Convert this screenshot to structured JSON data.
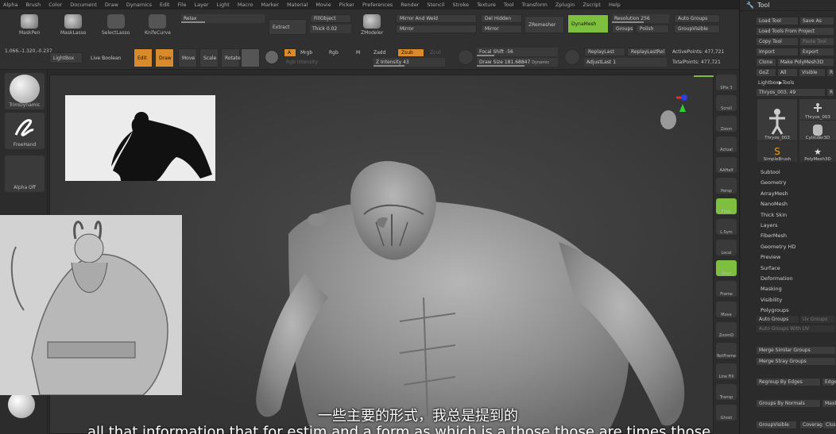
{
  "menu": [
    "Alpha",
    "Brush",
    "Color",
    "Document",
    "Draw",
    "Dynamics",
    "Edit",
    "File",
    "Layer",
    "Light",
    "Macro",
    "Marker",
    "Material",
    "Movie",
    "Picker",
    "Preferences",
    "Render",
    "Stencil",
    "Stroke",
    "Texture",
    "Tool",
    "Transform",
    "Zplugin",
    "Zscript",
    "Help"
  ],
  "coords": "1.066,-1.320,-0.237",
  "top_tools": {
    "masked": "MaskPen",
    "masklasso": "MaskLasso",
    "selectlasso": "SelectLasso",
    "knifecurve": "KnifeCurve",
    "relax": "Relax",
    "extract": "Extract",
    "fillobject": "FillObject",
    "thick_label": "Thick",
    "thick_value": "0.02",
    "zmodeler": "ZModeler",
    "mirror_weld": "Mirror And Weld",
    "mirror": "Mirror",
    "del_hidden": "Del Hidden",
    "mirror2": "Mirror",
    "zremesher": "ZRemesher",
    "dynamesh": "DynaMesh",
    "resolution_label": "Resolution",
    "resolution_value": "256",
    "groups": "Groups",
    "polish": "Polish",
    "auto_groups": "Auto Groups",
    "group_visible": "GroupVisible"
  },
  "shelf2": {
    "lightbox": "LightBox",
    "live_boolean": "Live Boolean",
    "edit": "Edit",
    "draw": "Draw",
    "move": "Move",
    "scale": "Scale",
    "rotate": "Rotate",
    "a": "A",
    "mrgb": "Mrgb",
    "rgb": "Rgb",
    "m": "M",
    "zadd": "Zadd",
    "zsub": "Zsub",
    "zcut": "Zcut",
    "rgb_intensity": "Rgb Intensity",
    "z_intensity_label": "Z Intensity",
    "z_intensity_value": "43",
    "focal_label": "Focal Shift",
    "focal_value": "-56",
    "draw_size_label": "Draw Size",
    "draw_size_value": "181.68847",
    "dynamic": "Dynamic",
    "replaylast": "ReplayLast",
    "replaylastrel": "ReplayLastRel",
    "adjustlast_label": "AdjustLast",
    "adjustlast_value": "1",
    "active_points": "ActivePoints: 477,721",
    "total_points": "TotalPoints: 477,721"
  },
  "left_shelf": [
    "TrimDynamic",
    "FreeHand",
    "Alpha Off"
  ],
  "right_shelf": [
    "SPix 3",
    "Scroll",
    "Zoom",
    "Actual",
    "AAHalf",
    "Persp",
    "Floor",
    "L.Sym",
    "Local",
    "Qxyz",
    "Frame",
    "Move",
    "ZoomD",
    "RotFrame",
    "Line Fill",
    "Transp",
    "Ghost"
  ],
  "tool_palette": {
    "title": "Tool",
    "load_tool": "Load Tool",
    "save_as": "Save As",
    "load_from_project": "Load Tools From Project",
    "copy_tool": "Copy Tool",
    "paste_tool": "Paste Tool",
    "import": "Import",
    "export": "Export",
    "clone": "Clone",
    "make_polymesh": "Make PolyMesh3D",
    "goz": "GoZ",
    "all": "All",
    "visible": "Visible",
    "r": "R",
    "lightbox_tools": "Lightbox▶Tools",
    "current_tool": "Thryos_003. 49",
    "r2": "R",
    "thumbs": [
      "Thryos_003",
      "Thryos_003",
      "Cylinder3D",
      "SimpleBrush",
      "PolyMesh3D"
    ],
    "sections": [
      "Subtool",
      "Geometry",
      "ArrayMesh",
      "NanoMesh",
      "Thick Skin",
      "Layers",
      "FiberMesh",
      "Geometry HD",
      "Preview",
      "Surface",
      "Deformation",
      "Masking",
      "Visibility",
      "Polygroups"
    ],
    "poly_auto_groups": "Auto Groups",
    "poly_uv_groups": "Uv Groups",
    "poly_auto_uv": "Auto Groups With UV",
    "merge_similar": "Merge Similar Groups",
    "merge_stray": "Merge Stray Groups",
    "regroup_edges": "Regroup By Edges",
    "edge": "Edge",
    "groups_by_normals": "Groups By Normals",
    "maxd": "MaxD",
    "group_visible": "GroupVisible",
    "coverage": "Coverag",
    "clus": "Clus"
  },
  "subtitle_cn": "一些主要的形式，我总是提到的",
  "subtitle_en": "all that information that for estim and a form as which is a those those are times those"
}
